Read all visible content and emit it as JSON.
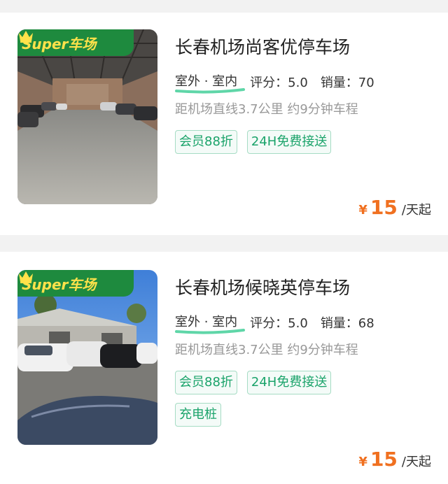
{
  "badge_text": "Super车场",
  "lots": [
    {
      "name": "长春机场尚客优停车场",
      "location": "室外 · 室内",
      "rating": "评分：5.0",
      "sales": "销量：70",
      "distance": "距机场直线3.7公里 约9分钟车程",
      "tags": [
        "会员88折",
        "24H免费接送"
      ],
      "currency": "¥",
      "price": "15",
      "price_unit": "/天起"
    },
    {
      "name": "长春机场候晓英停车场",
      "location": "室外 · 室内",
      "rating": "评分：5.0",
      "sales": "销量：68",
      "distance": "距机场直线3.7公里 约9分钟车程",
      "tags": [
        "会员88折",
        "24H免费接送",
        "充电桩"
      ],
      "currency": "¥",
      "price": "15",
      "price_unit": "/天起"
    }
  ],
  "colors": {
    "accent": "#1aa36a",
    "price": "#f07020",
    "badge": "#1e8a3e",
    "badge_text": "#ffe24a"
  }
}
